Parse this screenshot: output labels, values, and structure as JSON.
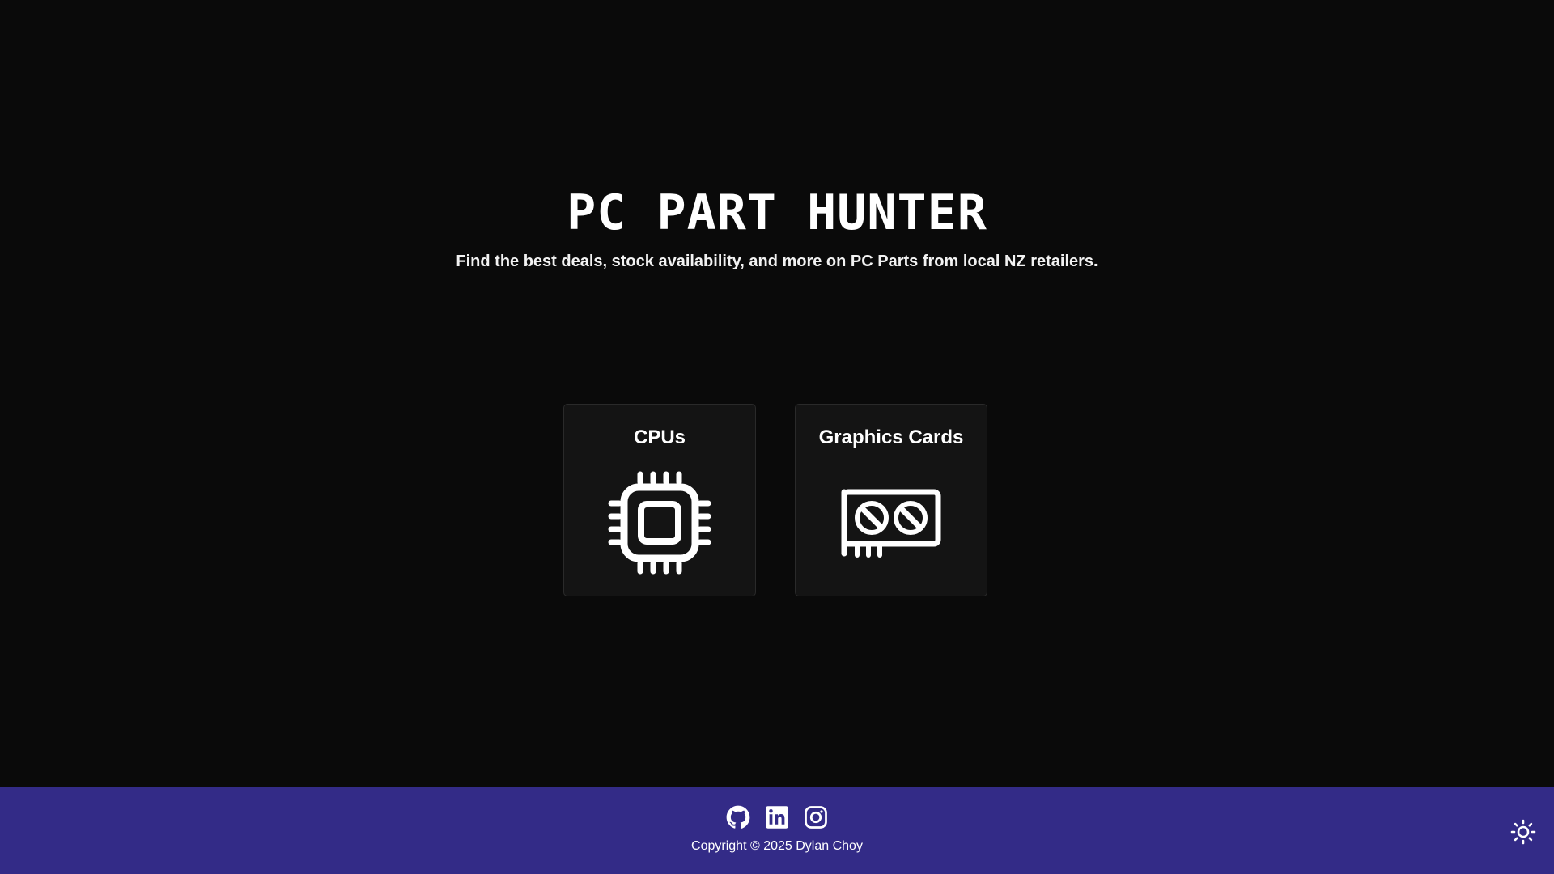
{
  "hero": {
    "title": "PC PART HUNTER",
    "subtitle": "Find the best deals, stock availability, and more on PC Parts from local NZ retailers."
  },
  "categories": [
    {
      "label": "CPUs",
      "icon": "cpu-icon"
    },
    {
      "label": "Graphics Cards",
      "icon": "graphics-card-icon"
    }
  ],
  "footer": {
    "social": [
      {
        "icon": "github-icon"
      },
      {
        "icon": "linkedin-icon"
      },
      {
        "icon": "instagram-icon"
      }
    ],
    "copyright": "Copyright © 2025 Dylan Choy",
    "theme_toggle_icon": "sun-icon"
  },
  "colors": {
    "background": "#0a0a0a",
    "card_background": "#141414",
    "footer_background": "#332b87",
    "text": "#ffffff"
  }
}
